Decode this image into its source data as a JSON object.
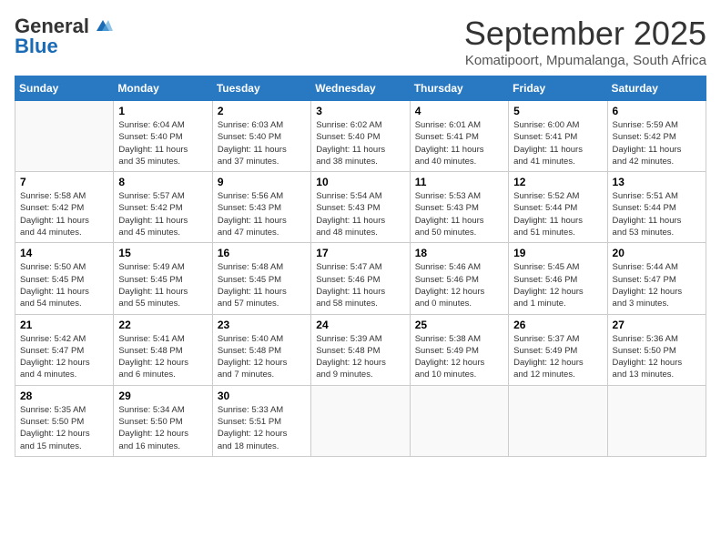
{
  "header": {
    "logo_line1": "General",
    "logo_line2": "Blue",
    "month": "September 2025",
    "location": "Komatipoort, Mpumalanga, South Africa"
  },
  "days_of_week": [
    "Sunday",
    "Monday",
    "Tuesday",
    "Wednesday",
    "Thursday",
    "Friday",
    "Saturday"
  ],
  "weeks": [
    [
      {
        "day": "",
        "info": ""
      },
      {
        "day": "1",
        "info": "Sunrise: 6:04 AM\nSunset: 5:40 PM\nDaylight: 11 hours\nand 35 minutes."
      },
      {
        "day": "2",
        "info": "Sunrise: 6:03 AM\nSunset: 5:40 PM\nDaylight: 11 hours\nand 37 minutes."
      },
      {
        "day": "3",
        "info": "Sunrise: 6:02 AM\nSunset: 5:40 PM\nDaylight: 11 hours\nand 38 minutes."
      },
      {
        "day": "4",
        "info": "Sunrise: 6:01 AM\nSunset: 5:41 PM\nDaylight: 11 hours\nand 40 minutes."
      },
      {
        "day": "5",
        "info": "Sunrise: 6:00 AM\nSunset: 5:41 PM\nDaylight: 11 hours\nand 41 minutes."
      },
      {
        "day": "6",
        "info": "Sunrise: 5:59 AM\nSunset: 5:42 PM\nDaylight: 11 hours\nand 42 minutes."
      }
    ],
    [
      {
        "day": "7",
        "info": "Sunrise: 5:58 AM\nSunset: 5:42 PM\nDaylight: 11 hours\nand 44 minutes."
      },
      {
        "day": "8",
        "info": "Sunrise: 5:57 AM\nSunset: 5:42 PM\nDaylight: 11 hours\nand 45 minutes."
      },
      {
        "day": "9",
        "info": "Sunrise: 5:56 AM\nSunset: 5:43 PM\nDaylight: 11 hours\nand 47 minutes."
      },
      {
        "day": "10",
        "info": "Sunrise: 5:54 AM\nSunset: 5:43 PM\nDaylight: 11 hours\nand 48 minutes."
      },
      {
        "day": "11",
        "info": "Sunrise: 5:53 AM\nSunset: 5:43 PM\nDaylight: 11 hours\nand 50 minutes."
      },
      {
        "day": "12",
        "info": "Sunrise: 5:52 AM\nSunset: 5:44 PM\nDaylight: 11 hours\nand 51 minutes."
      },
      {
        "day": "13",
        "info": "Sunrise: 5:51 AM\nSunset: 5:44 PM\nDaylight: 11 hours\nand 53 minutes."
      }
    ],
    [
      {
        "day": "14",
        "info": "Sunrise: 5:50 AM\nSunset: 5:45 PM\nDaylight: 11 hours\nand 54 minutes."
      },
      {
        "day": "15",
        "info": "Sunrise: 5:49 AM\nSunset: 5:45 PM\nDaylight: 11 hours\nand 55 minutes."
      },
      {
        "day": "16",
        "info": "Sunrise: 5:48 AM\nSunset: 5:45 PM\nDaylight: 11 hours\nand 57 minutes."
      },
      {
        "day": "17",
        "info": "Sunrise: 5:47 AM\nSunset: 5:46 PM\nDaylight: 11 hours\nand 58 minutes."
      },
      {
        "day": "18",
        "info": "Sunrise: 5:46 AM\nSunset: 5:46 PM\nDaylight: 12 hours\nand 0 minutes."
      },
      {
        "day": "19",
        "info": "Sunrise: 5:45 AM\nSunset: 5:46 PM\nDaylight: 12 hours\nand 1 minute."
      },
      {
        "day": "20",
        "info": "Sunrise: 5:44 AM\nSunset: 5:47 PM\nDaylight: 12 hours\nand 3 minutes."
      }
    ],
    [
      {
        "day": "21",
        "info": "Sunrise: 5:42 AM\nSunset: 5:47 PM\nDaylight: 12 hours\nand 4 minutes."
      },
      {
        "day": "22",
        "info": "Sunrise: 5:41 AM\nSunset: 5:48 PM\nDaylight: 12 hours\nand 6 minutes."
      },
      {
        "day": "23",
        "info": "Sunrise: 5:40 AM\nSunset: 5:48 PM\nDaylight: 12 hours\nand 7 minutes."
      },
      {
        "day": "24",
        "info": "Sunrise: 5:39 AM\nSunset: 5:48 PM\nDaylight: 12 hours\nand 9 minutes."
      },
      {
        "day": "25",
        "info": "Sunrise: 5:38 AM\nSunset: 5:49 PM\nDaylight: 12 hours\nand 10 minutes."
      },
      {
        "day": "26",
        "info": "Sunrise: 5:37 AM\nSunset: 5:49 PM\nDaylight: 12 hours\nand 12 minutes."
      },
      {
        "day": "27",
        "info": "Sunrise: 5:36 AM\nSunset: 5:50 PM\nDaylight: 12 hours\nand 13 minutes."
      }
    ],
    [
      {
        "day": "28",
        "info": "Sunrise: 5:35 AM\nSunset: 5:50 PM\nDaylight: 12 hours\nand 15 minutes."
      },
      {
        "day": "29",
        "info": "Sunrise: 5:34 AM\nSunset: 5:50 PM\nDaylight: 12 hours\nand 16 minutes."
      },
      {
        "day": "30",
        "info": "Sunrise: 5:33 AM\nSunset: 5:51 PM\nDaylight: 12 hours\nand 18 minutes."
      },
      {
        "day": "",
        "info": ""
      },
      {
        "day": "",
        "info": ""
      },
      {
        "day": "",
        "info": ""
      },
      {
        "day": "",
        "info": ""
      }
    ]
  ]
}
